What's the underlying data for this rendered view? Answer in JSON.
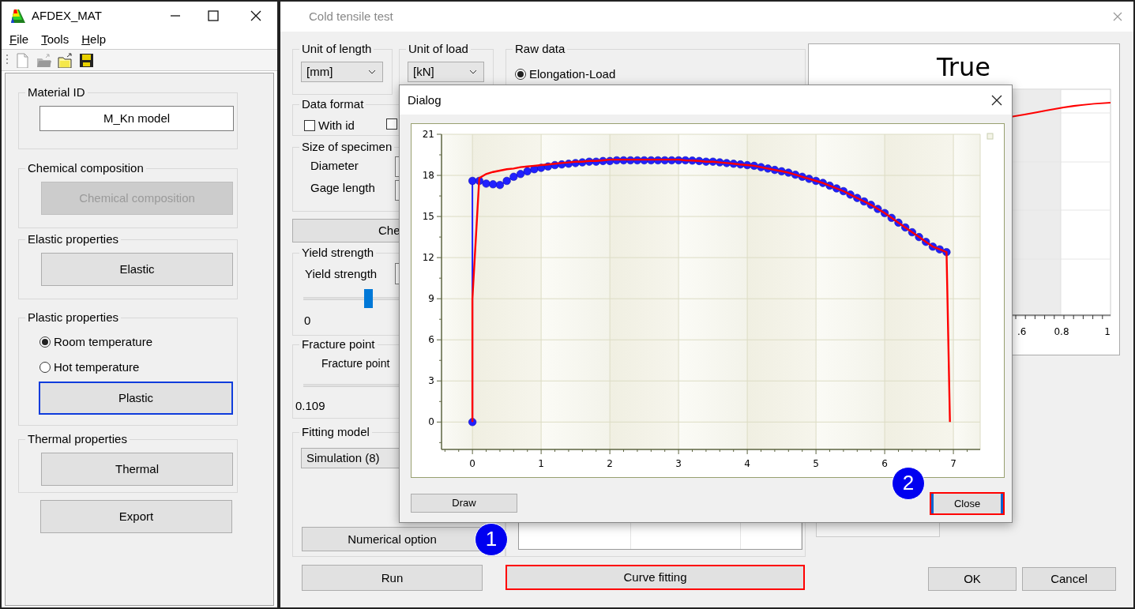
{
  "main_window": {
    "title": "AFDEX_MAT",
    "menu": [
      {
        "label": "File",
        "mnemonic": true
      },
      {
        "label": "Tools",
        "mnemonic": true
      },
      {
        "label": "Help",
        "mnemonic": true
      }
    ],
    "toolbar": [
      {
        "kind": "new",
        "disabled": false
      },
      {
        "kind": "open",
        "disabled": true
      },
      {
        "kind": "open",
        "disabled": false
      },
      {
        "kind": "save",
        "disabled": false
      }
    ],
    "groups": [
      {
        "title": "Material ID",
        "controls": [
          {
            "kind": "field",
            "value": "M_Kn model"
          }
        ]
      },
      {
        "title": "Chemical composition",
        "controls": [
          {
            "kind": "button",
            "label": "Chemical composition",
            "disabled": true,
            "focused": false
          }
        ]
      },
      {
        "title": "Elastic properties",
        "controls": [
          {
            "kind": "button",
            "label": "Elastic",
            "disabled": false,
            "focused": false
          }
        ]
      },
      {
        "title": "Plastic properties",
        "controls": [
          {
            "kind": "radio",
            "label": "Room temperature",
            "selected": true
          },
          {
            "kind": "radio",
            "label": "Hot temperature",
            "selected": false
          },
          {
            "kind": "button",
            "label": "Plastic",
            "disabled": false,
            "focused": true
          }
        ]
      },
      {
        "title": "Thermal properties",
        "controls": [
          {
            "kind": "button",
            "label": "Thermal",
            "disabled": false,
            "focused": false
          }
        ]
      }
    ],
    "export_button": {
      "label": "Export"
    }
  },
  "test_window": {
    "title": "Cold tensile test",
    "unit_of_length": {
      "label": "Unit of length",
      "value": "[mm]"
    },
    "unit_of_load": {
      "label": "Unit of load",
      "value": "[kN]"
    },
    "data_format": {
      "label": "Data format",
      "checkboxes": [
        {
          "label": "With id",
          "checked": false
        },
        {
          "checked": false
        }
      ]
    },
    "size_of_specimen": {
      "label": "Size of specimen",
      "fields": [
        {
          "label": "Diameter"
        },
        {
          "label": "Gage length"
        }
      ]
    },
    "check_button": {
      "label": "Che"
    },
    "yield_strength": {
      "label": "Yield strength",
      "field_label": "Yield strength",
      "slider": {
        "level": 0.34
      },
      "minimum": "0"
    },
    "fracture_point": {
      "label": "Fracture point",
      "field_label": "Fracture point",
      "value": "0.109"
    },
    "fitting_model": {
      "label": "Fitting model",
      "value": "Simulation (8)",
      "option_button": "Numerical option"
    },
    "raw_data": {
      "label": "Raw data",
      "options": [
        {
          "label": "Elongation-Load",
          "selected": true
        }
      ]
    },
    "true_chart": {
      "title": "True",
      "tick_labels": [
        ".6",
        "0.8",
        "1"
      ]
    },
    "buttons": [
      {
        "label": "Run",
        "highlighted": false
      },
      {
        "label": "Curve fitting",
        "highlighted": true
      },
      {
        "label": "OK",
        "highlighted": false
      },
      {
        "label": "Cancel",
        "highlighted": false
      }
    ]
  },
  "dialog": {
    "title": "Dialog",
    "chart_data": {
      "type": "line",
      "grid": true,
      "xlim": [
        -0.45,
        7.39
      ],
      "ylim": [
        -2,
        21
      ],
      "xticks": [
        0,
        1,
        2,
        3,
        4,
        5,
        6,
        7
      ],
      "yticks": [
        0,
        3,
        6,
        9,
        12,
        15,
        18,
        21
      ],
      "x": [
        0,
        0,
        0.1,
        0.2,
        0.3,
        0.4,
        0.5,
        0.6,
        0.7,
        0.8,
        0.9,
        1.0,
        1.1,
        1.2,
        1.3,
        1.4,
        1.5,
        1.6,
        1.7,
        1.8,
        1.9,
        2.0,
        2.1,
        2.2,
        2.3,
        2.4,
        2.5,
        2.6,
        2.7,
        2.8,
        2.9,
        3.0,
        3.1,
        3.2,
        3.3,
        3.4,
        3.5,
        3.6,
        3.7,
        3.8,
        3.9,
        4.0,
        4.1,
        4.2,
        4.3,
        4.4,
        4.5,
        4.6,
        4.7,
        4.8,
        4.9,
        5.0,
        5.1,
        5.2,
        5.3,
        5.4,
        5.5,
        5.6,
        5.7,
        5.8,
        5.9,
        6.0,
        6.1,
        6.2,
        6.3,
        6.4,
        6.5,
        6.6,
        6.7,
        6.8,
        6.9,
        6.95
      ],
      "series": [
        {
          "color": "#ff0000",
          "values": [
            0,
            9,
            17.8,
            18.1,
            18.25,
            18.35,
            18.45,
            18.5,
            18.6,
            18.65,
            18.7,
            18.75,
            18.8,
            18.85,
            18.9,
            18.95,
            19.0,
            19.0,
            19.05,
            19.05,
            19.1,
            19.15,
            19.15,
            19.15,
            19.15,
            19.15,
            19.15,
            19.15,
            19.15,
            19.15,
            19.15,
            19.15,
            19.1,
            19.08,
            19.05,
            19.0,
            19.0,
            18.95,
            18.9,
            18.85,
            18.8,
            18.75,
            18.7,
            18.6,
            18.5,
            18.4,
            18.3,
            18.2,
            18.05,
            17.9,
            17.75,
            17.6,
            17.45,
            17.25,
            17.05,
            16.85,
            16.6,
            16.35,
            16.1,
            15.85,
            15.55,
            15.25,
            14.9,
            14.55,
            14.2,
            13.85,
            13.5,
            13.15,
            12.8,
            12.6,
            12.4,
            0
          ]
        },
        {
          "color": "#2020ff",
          "marker": true,
          "values": [
            0,
            17.6,
            17.6,
            17.4,
            17.35,
            17.3,
            17.6,
            17.9,
            18.1,
            18.3,
            18.45,
            18.55,
            18.65,
            18.75,
            18.8,
            18.85,
            18.9,
            18.95,
            19.0,
            19.0,
            19.05,
            19.05,
            19.1,
            19.1,
            19.1,
            19.1,
            19.1,
            19.1,
            19.1,
            19.1,
            19.1,
            19.1,
            19.1,
            19.08,
            19.05,
            19.0,
            19.0,
            18.95,
            18.9,
            18.85,
            18.8,
            18.75,
            18.7,
            18.6,
            18.5,
            18.4,
            18.3,
            18.2,
            18.05,
            17.9,
            17.75,
            17.6,
            17.45,
            17.25,
            17.05,
            16.85,
            16.6,
            16.35,
            16.1,
            15.85,
            15.55,
            15.25,
            14.9,
            14.55,
            14.2,
            13.85,
            13.5,
            13.15,
            12.8,
            12.6,
            12.4,
            null
          ]
        }
      ]
    },
    "buttons": [
      {
        "label": "Draw",
        "highlighted": false
      },
      {
        "label": "Close",
        "highlighted": true
      }
    ]
  },
  "callouts": [
    {
      "text": "1"
    },
    {
      "text": "2"
    }
  ]
}
